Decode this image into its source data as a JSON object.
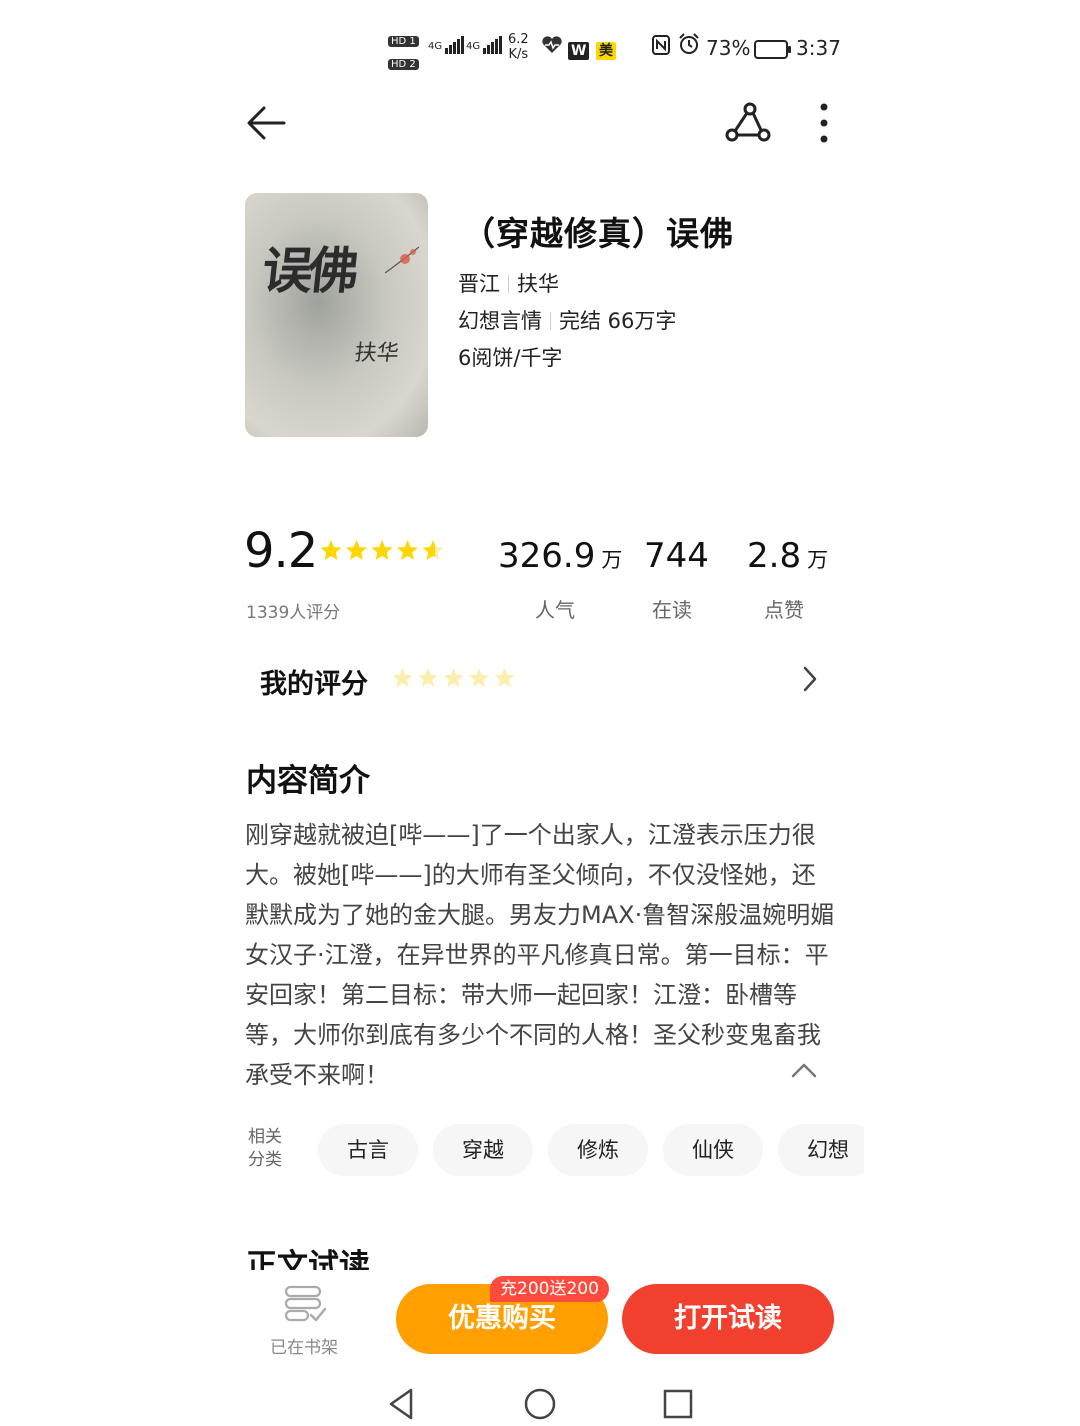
{
  "status_bar": {
    "hd1": "HD 1",
    "hd2": "HD 2",
    "sim1": "4G",
    "sim2": "4G",
    "net_speed_value": "6.2",
    "net_speed_unit": "K/s",
    "app_badge_w": "W",
    "app_badge_mei": "美",
    "battery": "73%",
    "time": "3:37"
  },
  "book": {
    "cover_title": "误佛",
    "cover_author": "扶华",
    "title": "（穿越修真）误佛",
    "source": "晋江",
    "author": "扶华",
    "genre": "幻想言情",
    "status": "完结 66万字",
    "price": "6阅饼/千字"
  },
  "rating": {
    "score": "9.2",
    "stars_value": 4.6,
    "count": "1339人评分"
  },
  "stats": [
    {
      "value": "326.9",
      "unit": "万",
      "label": "人气"
    },
    {
      "value": "744",
      "unit": "",
      "label": "在读"
    },
    {
      "value": "2.8",
      "unit": "万",
      "label": "点赞"
    }
  ],
  "my_rating": {
    "label": "我的评分",
    "stars_value": 0
  },
  "synopsis": {
    "title": "内容简介",
    "text": "刚穿越就被迫[哔——]了一个出家人，江澄表示压力很大。被她[哔——]的大师有圣父倾向，不仅没怪她，还默默成为了她的金大腿。男友力MAX·鲁智深般温婉明媚女汉子·江澄，在异世界的平凡修真日常。第一目标：平安回家！第二目标：带大师一起回家！江澄：卧槽等等，大师你到底有多少个不同的人格！圣父秒变鬼畜我承受不来啊！"
  },
  "tags": {
    "label_line1": "相关",
    "label_line2": "分类",
    "items": [
      "古言",
      "穿越",
      "修炼",
      "仙侠",
      "幻想"
    ]
  },
  "trial": {
    "title": "正文试读"
  },
  "bottom": {
    "bookshelf_label": "已在书架",
    "buy_label": "优惠购买",
    "promo": "充200送200",
    "read_label": "打开试读"
  },
  "colors": {
    "star": "#ffd600",
    "star_empty": "#fbefb0",
    "buy": "#ff9f00",
    "read": "#f2402f",
    "promo": "#ff4b3e"
  },
  "icons": [
    "back-arrow-icon",
    "share-icon",
    "more-vert-icon",
    "chevron-right-icon",
    "chevron-up-icon",
    "bookshelf-icon",
    "nav-back-icon",
    "nav-home-icon",
    "nav-recents-icon"
  ]
}
